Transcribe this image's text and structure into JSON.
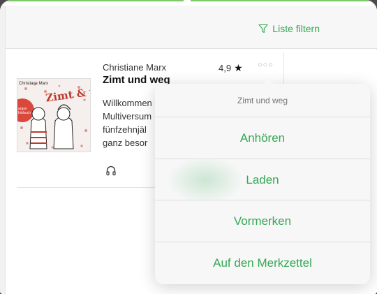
{
  "toolbar": {
    "filter_label": "Liste filtern",
    "filter_icon": "funnel-icon"
  },
  "book": {
    "author": "Christiane Marx",
    "title": "Zimt und weg",
    "rating": "4,9",
    "more_icon": "ellipsis-icon",
    "description_lines": [
      "Willkommen",
      "Multiversum",
      "fünfzehnjäl",
      "ganz besor"
    ],
    "cover": {
      "author_text": "Christiane Marx",
      "title_text": "Zimt & weg",
      "publisher_badge": "argon hörbuch"
    },
    "media_icon": "headphones-icon"
  },
  "popover": {
    "title": "Zimt und weg",
    "actions": [
      "Anhören",
      "Laden",
      "Vormerken",
      "Auf den Merkzettel"
    ]
  },
  "colors": {
    "accent": "#34a853",
    "top_bar": "#7ec86a"
  }
}
